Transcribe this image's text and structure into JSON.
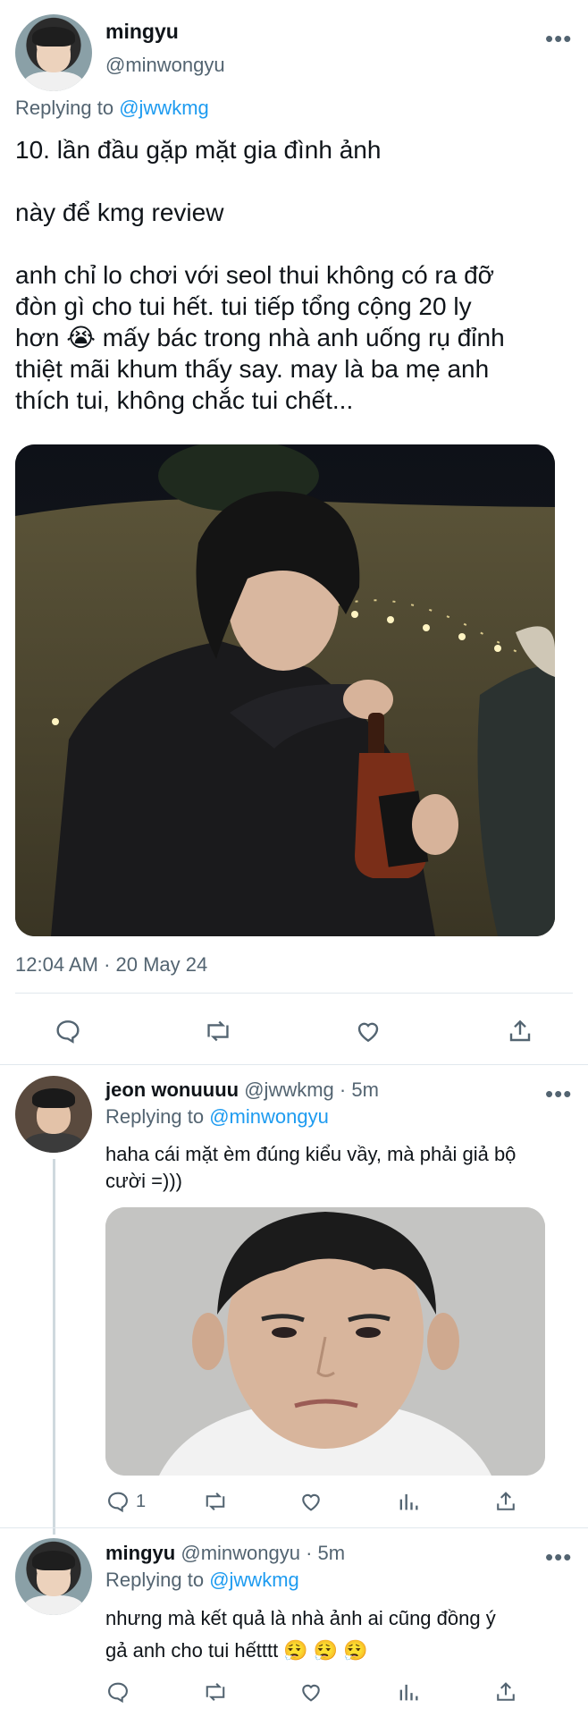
{
  "main_tweet": {
    "name": "mingyu",
    "handle": "@minwongyu",
    "replying_prefix": "Replying to",
    "replying_to": "@jwwkmg",
    "lines": [
      "10. lần đầu gặp mặt gia đình ảnh",
      "",
      "này để kmg review",
      "",
      "anh chỉ lo chơi với seol thui không có ra đỡ",
      "đòn gì cho tui hết. tui tiếp tổng cộng 20 ly",
      "hơn 😭  mấy bác trong nhà anh uống rụ đỉnh",
      "thiệt mãi khum thấy say. may là ba mẹ anh",
      "thích tui, không chắc tui chết..."
    ],
    "timestamp": "12:04 AM · 20 May 24",
    "icons": [
      "reply-icon",
      "retweet-icon",
      "like-icon",
      "share-icon"
    ]
  },
  "reply1": {
    "name": "jeon wonuuuu",
    "handle": "@jwwkmg",
    "time": "· 5m",
    "replying_prefix": "Replying to",
    "replying_to": "@minwongyu",
    "line1": "haha cái mặt èm đúng kiểu vầy, mà phải giả bộ",
    "line2": "cười =)))",
    "reply_count": "1"
  },
  "reply2": {
    "name": "mingyu",
    "handle": "@minwongyu",
    "time": "· 5m",
    "replying_prefix": "Replying to",
    "replying_to": "@jwwkmg",
    "line1": "nhưng mà kết quả là nhà ảnh ai cũng đồng ý",
    "line2": "gả anh cho tui hếtttt 😮‍💨 😮‍💨 😮‍💨"
  },
  "more_glyph": "•••",
  "colors": {
    "link": "#1d9bf0",
    "muted": "#536471",
    "text": "#0f1419",
    "divider": "#e1e8ed"
  }
}
